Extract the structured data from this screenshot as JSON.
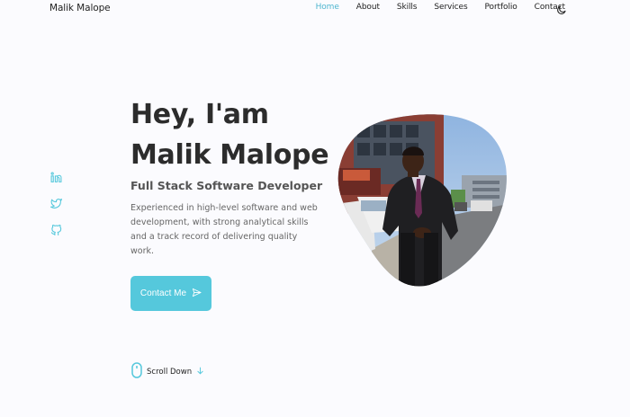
{
  "header": {
    "logo": "Malik Malope",
    "nav": [
      {
        "label": "Home",
        "active": true
      },
      {
        "label": "About",
        "active": false
      },
      {
        "label": "Skills",
        "active": false
      },
      {
        "label": "Services",
        "active": false
      },
      {
        "label": "Portfolio",
        "active": false
      },
      {
        "label": "Contact",
        "active": false
      }
    ],
    "theme_icon": "moon-icon"
  },
  "social": [
    "linkedin-icon",
    "twitter-icon",
    "github-icon"
  ],
  "hero": {
    "greeting": "Hey, I'am",
    "name": "Malik Malope",
    "subtitle": "Full Stack Software Developer",
    "description": "Experienced in high-level software and web development, with strong analytical skills and a track record of delivering quality work.",
    "cta_label": "Contact Me",
    "cta_icon": "send-icon"
  },
  "scroll": {
    "label": "Scroll Down",
    "mouse_icon": "mouse-icon",
    "arrow_icon": "arrow-down-icon"
  },
  "colors": {
    "accent": "#55c8dc",
    "nav_active": "#4fb6cf",
    "background": "#fbfbfe"
  }
}
